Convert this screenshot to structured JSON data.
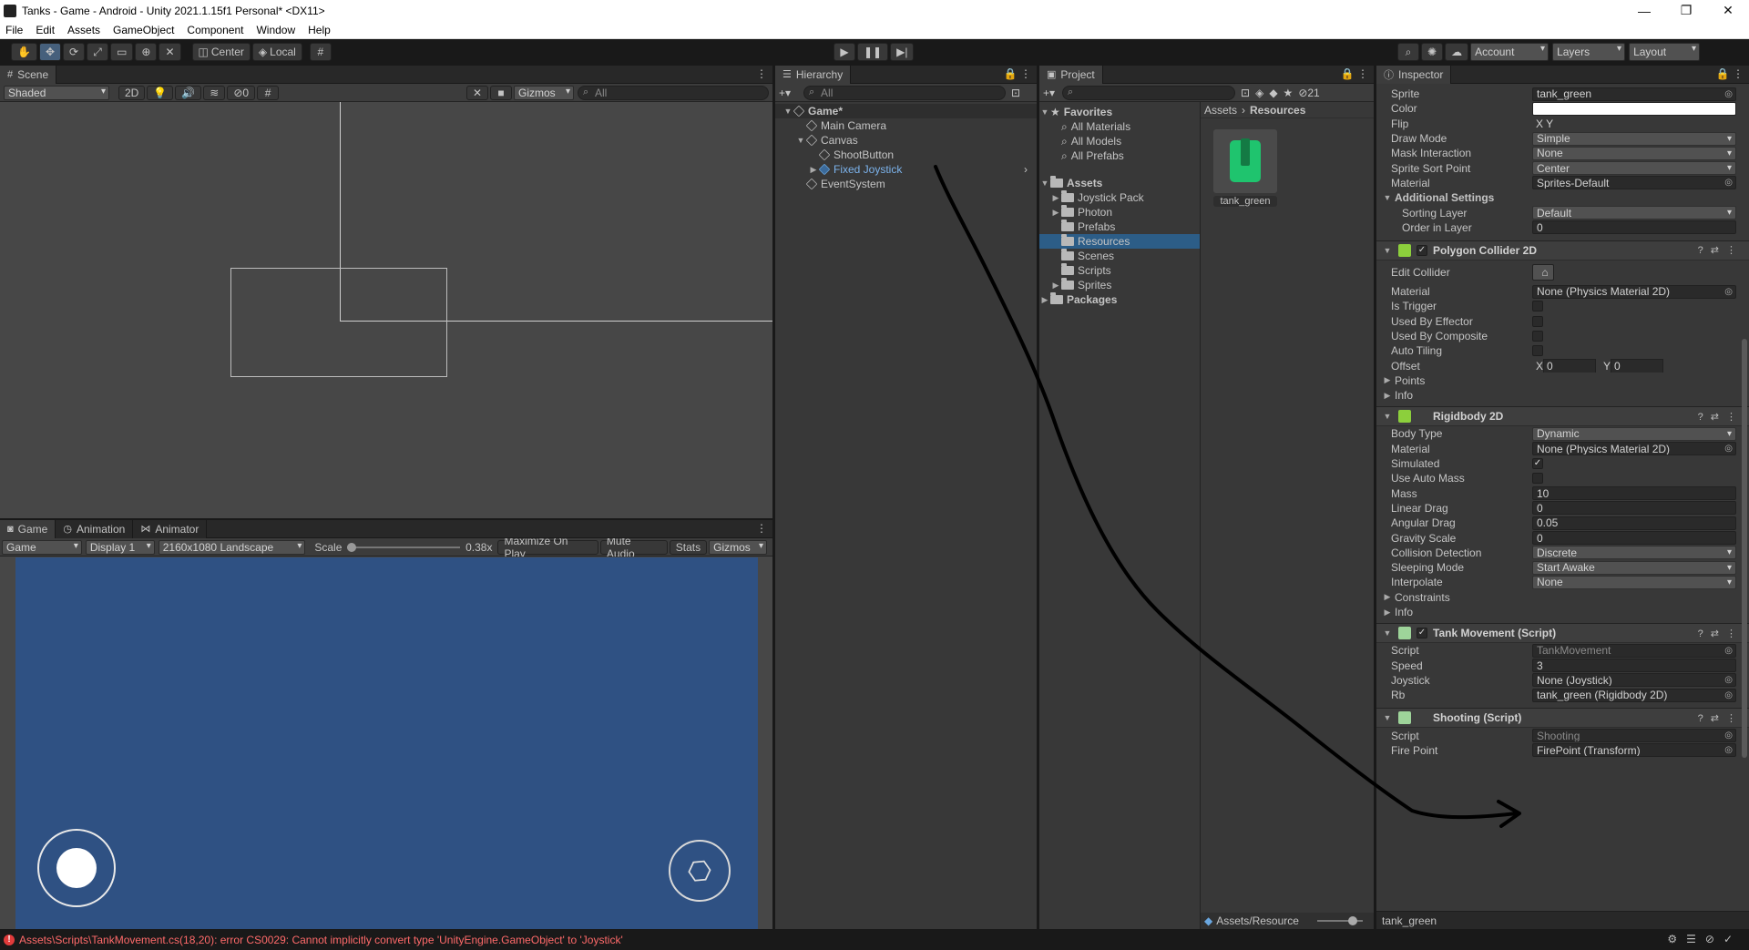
{
  "window": {
    "title": "Tanks - Game - Android - Unity 2021.1.15f1 Personal* <DX11>"
  },
  "menu": [
    "File",
    "Edit",
    "Assets",
    "GameObject",
    "Component",
    "Window",
    "Help"
  ],
  "toolbar": {
    "pivot": "Center",
    "space": "Local",
    "account": "Account",
    "layers": "Layers",
    "layout": "Layout"
  },
  "scene": {
    "tab": "Scene",
    "shading": "Shaded",
    "mode2d": "2D",
    "hidden_count": "0",
    "gizmos": "Gizmos",
    "search_placeholder": "All"
  },
  "game": {
    "tabs": [
      "Game",
      "Animation",
      "Animator"
    ],
    "display_mode": "Game",
    "display": "Display 1",
    "resolution": "2160x1080 Landscape",
    "scale_label": "Scale",
    "scale_value": "0.38x",
    "maximize": "Maximize On Play",
    "mute": "Mute Audio",
    "stats": "Stats",
    "gizmos": "Gizmos",
    "bg_color": "#2f5183"
  },
  "hierarchy": {
    "tab": "Hierarchy",
    "search_placeholder": "All",
    "items": [
      {
        "label": "Game*",
        "depth": 0,
        "arrow": "▼",
        "kind": "scene"
      },
      {
        "label": "Main Camera",
        "depth": 1,
        "arrow": "",
        "kind": "obj"
      },
      {
        "label": "Canvas",
        "depth": 1,
        "arrow": "▼",
        "kind": "obj"
      },
      {
        "label": "ShootButton",
        "depth": 2,
        "arrow": "",
        "kind": "obj"
      },
      {
        "label": "Fixed Joystick",
        "depth": 2,
        "arrow": "▶",
        "kind": "prefab"
      },
      {
        "label": "EventSystem",
        "depth": 1,
        "arrow": "",
        "kind": "obj"
      }
    ]
  },
  "project": {
    "tab": "Project",
    "hidden_count": "21",
    "favorites": {
      "label": "Favorites",
      "items": [
        "All Materials",
        "All Models",
        "All Prefabs"
      ]
    },
    "assets": {
      "label": "Assets",
      "items": [
        {
          "label": "Joystick Pack",
          "arrow": "▶"
        },
        {
          "label": "Photon",
          "arrow": "▶"
        },
        {
          "label": "Prefabs",
          "arrow": ""
        },
        {
          "label": "Resources",
          "arrow": "",
          "selected": true
        },
        {
          "label": "Scenes",
          "arrow": ""
        },
        {
          "label": "Scripts",
          "arrow": ""
        },
        {
          "label": "Sprites",
          "arrow": "▶"
        }
      ]
    },
    "packages": "Packages",
    "breadcrumb": [
      "Assets",
      "Resources"
    ],
    "asset_name": "tank_green",
    "footer_path": "Assets/Resource"
  },
  "inspector": {
    "tab": "Inspector",
    "footer": "tank_green",
    "sprite_renderer": [
      {
        "label": "Sprite",
        "value": "tank_green",
        "type": "obj"
      },
      {
        "label": "Color",
        "value": "",
        "type": "color"
      },
      {
        "label": "Flip",
        "value": "X   Y",
        "type": "flip"
      },
      {
        "label": "Draw Mode",
        "value": "Simple",
        "type": "dd"
      },
      {
        "label": "Mask Interaction",
        "value": "None",
        "type": "dd"
      },
      {
        "label": "Sprite Sort Point",
        "value": "Center",
        "type": "dd"
      },
      {
        "label": "Material",
        "value": "Sprites-Default",
        "type": "obj"
      }
    ],
    "additional_settings": {
      "label": "Additional Settings",
      "rows": [
        {
          "label": "Sorting Layer",
          "value": "Default",
          "type": "dd"
        },
        {
          "label": "Order in Layer",
          "value": "0",
          "type": "field"
        }
      ]
    },
    "polygon_collider": {
      "title": "Polygon Collider 2D",
      "rows": [
        {
          "label": "Edit Collider",
          "value": "",
          "type": "editbtn"
        },
        {
          "label": "Material",
          "value": "None (Physics Material 2D)",
          "type": "obj"
        },
        {
          "label": "Is Trigger",
          "value": "",
          "type": "chk"
        },
        {
          "label": "Used By Effector",
          "value": "",
          "type": "chk"
        },
        {
          "label": "Used By Composite",
          "value": "",
          "type": "chk"
        },
        {
          "label": "Auto Tiling",
          "value": "",
          "type": "chk"
        },
        {
          "label": "Offset",
          "value": "",
          "type": "offset",
          "x": "0",
          "y": "0"
        }
      ],
      "folds": [
        "Points",
        "Info"
      ]
    },
    "rigidbody": {
      "title": "Rigidbody 2D",
      "rows": [
        {
          "label": "Body Type",
          "value": "Dynamic",
          "type": "dd"
        },
        {
          "label": "Material",
          "value": "None (Physics Material 2D)",
          "type": "obj"
        },
        {
          "label": "Simulated",
          "value": "✓",
          "type": "chk"
        },
        {
          "label": "Use Auto Mass",
          "value": "",
          "type": "chk"
        },
        {
          "label": "Mass",
          "value": "10",
          "type": "field"
        },
        {
          "label": "Linear Drag",
          "value": "0",
          "type": "field"
        },
        {
          "label": "Angular Drag",
          "value": "0.05",
          "type": "field"
        },
        {
          "label": "Gravity Scale",
          "value": "0",
          "type": "field"
        },
        {
          "label": "Collision Detection",
          "value": "Discrete",
          "type": "dd"
        },
        {
          "label": "Sleeping Mode",
          "value": "Start Awake",
          "type": "dd"
        },
        {
          "label": "Interpolate",
          "value": "None",
          "type": "dd"
        }
      ],
      "folds": [
        "Constraints",
        "Info"
      ]
    },
    "tank_movement": {
      "title": "Tank Movement (Script)",
      "rows": [
        {
          "label": "Script",
          "value": "TankMovement",
          "type": "ro"
        },
        {
          "label": "Speed",
          "value": "3",
          "type": "field"
        },
        {
          "label": "Joystick",
          "value": "None (Joystick)",
          "type": "obj"
        },
        {
          "label": "Rb",
          "value": "tank_green (Rigidbody 2D)",
          "type": "obj"
        }
      ]
    },
    "shooting": {
      "title": "Shooting (Script)",
      "rows": [
        {
          "label": "Script",
          "value": "Shooting",
          "type": "ro"
        },
        {
          "label": "Fire Point",
          "value": "FirePoint (Transform)",
          "type": "obj"
        }
      ]
    }
  },
  "status": {
    "error": "Assets\\Scripts\\TankMovement.cs(18,20): error CS0029: Cannot implicitly convert type 'UnityEngine.GameObject' to 'Joystick'"
  }
}
